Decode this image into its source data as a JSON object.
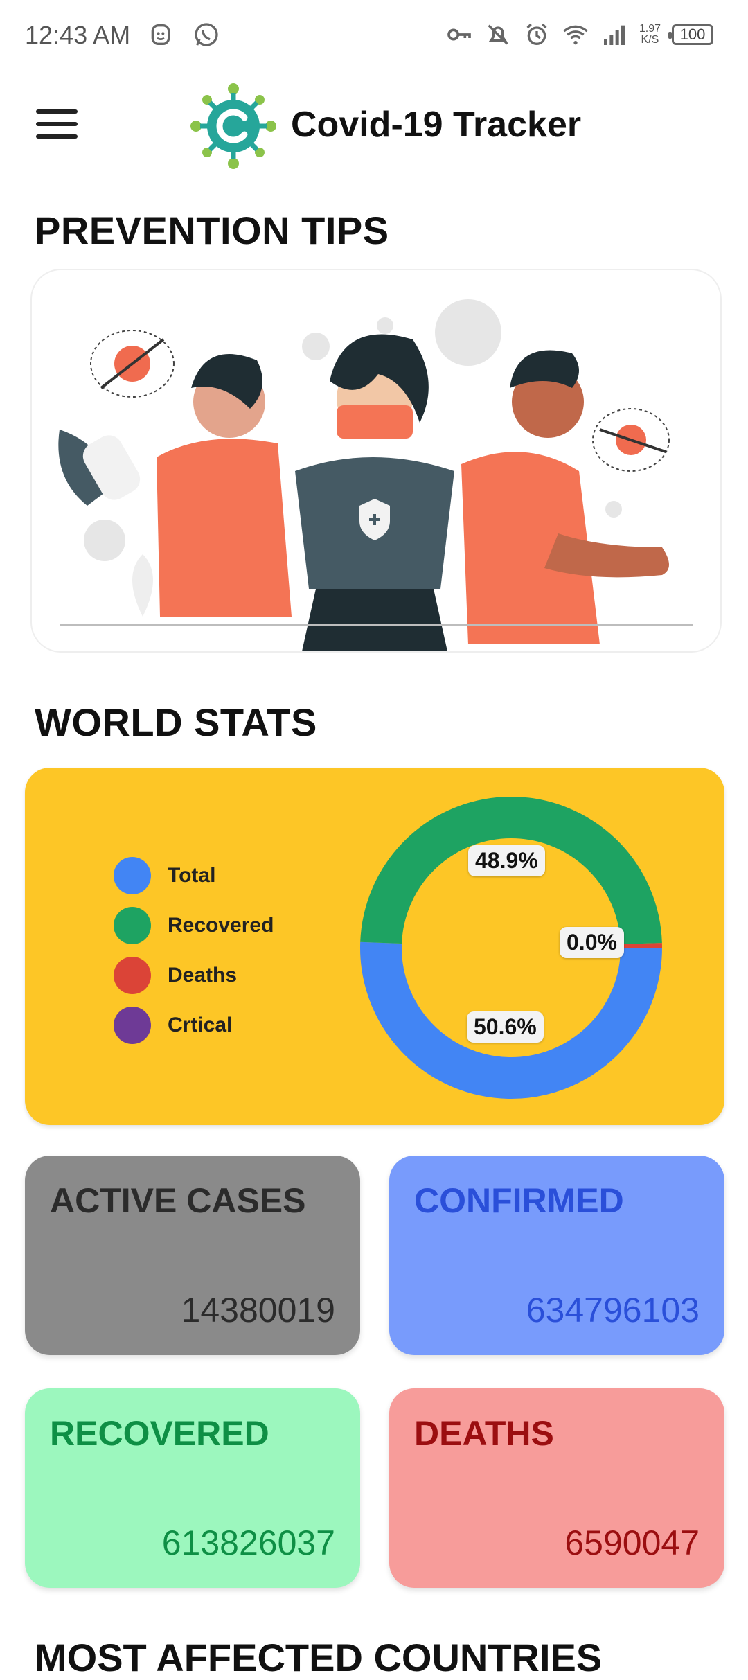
{
  "status_bar": {
    "time": "12:43 AM",
    "net_speed_value": "1.97",
    "net_speed_unit": "K/S",
    "battery": "100",
    "icons": [
      "face-unlock-icon",
      "whatsapp-icon",
      "vpn-key-icon",
      "notifications-off-icon",
      "alarm-icon",
      "wifi-icon",
      "signal-icon"
    ]
  },
  "app_bar": {
    "title": "Covid-19 Tracker",
    "menu_icon": "menu-icon",
    "logo_icon": "virus-logo-icon"
  },
  "sections": {
    "prevention_title": "PREVENTION TIPS",
    "world_stats_title": "WORLD STATS",
    "most_affected_title": "MOST AFFECTED COUNTRIES"
  },
  "chart_data": {
    "type": "pie",
    "legend": [
      "Total",
      "Recovered",
      "Deaths",
      "Crtical"
    ],
    "colors": {
      "Total": "#4285F4",
      "Recovered": "#1EA362",
      "Deaths": "#DB4437",
      "Crtical": "#6E3A96"
    },
    "slices": [
      {
        "name": "Total",
        "value": 50.6,
        "label": "50.6%"
      },
      {
        "name": "Recovered",
        "value": 48.9,
        "label": "48.9%"
      },
      {
        "name": "Deaths",
        "value": 0.5,
        "label": "0.0%"
      }
    ],
    "legend_position": "left"
  },
  "cards": {
    "active": {
      "label": "ACTIVE CASES",
      "value": "14380019"
    },
    "confirmed": {
      "label": "CONFIRMED",
      "value": "634796103"
    },
    "recovered": {
      "label": "RECOVERED",
      "value": "613826037"
    },
    "deaths": {
      "label": "DEATHS",
      "value": "6590047"
    }
  },
  "colors": {
    "stats_background": "#FDC626",
    "active_bg": "#8A8A8A",
    "confirmed_bg": "#789BFC",
    "recovered_bg": "#9CF7BE",
    "deaths_bg": "#F79C9A"
  }
}
